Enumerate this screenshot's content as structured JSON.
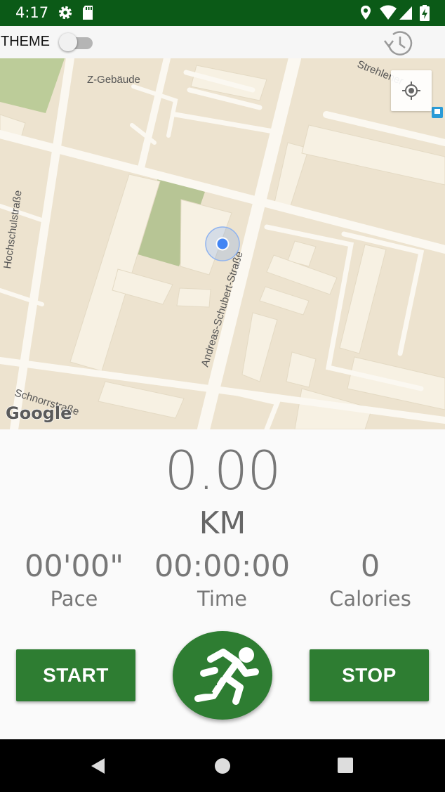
{
  "status_bar": {
    "time": "4:17",
    "icons": [
      "gear-icon",
      "sd-card-icon",
      "location-pin-icon",
      "wifi-icon",
      "signal-icon",
      "battery-charging-icon"
    ]
  },
  "toolbar": {
    "theme_label": "THEME",
    "theme_switch_on": false,
    "history_icon": "history-clock-icon"
  },
  "map": {
    "labels": {
      "z_gebaude": "Z-Gebäude",
      "strehlener": "Strehlener",
      "hochschul": "Hochschulstraße",
      "andreas": "Andreas-Schubert-Straße",
      "schnorr": "Schnorrstraße"
    },
    "attribution": "Google",
    "my_location_icon": "my-location-icon",
    "marker": "current-location-dot"
  },
  "stats": {
    "distance": "0.00",
    "unit": "KM",
    "pace_value": "00'00\"",
    "pace_label": "Pace",
    "time_value": "00:00:00",
    "time_label": "Time",
    "calories_value": "0",
    "calories_label": "Calories"
  },
  "actions": {
    "start_label": "START",
    "stop_label": "STOP",
    "run_icon": "running-person-icon"
  },
  "nav_bar": {
    "icons": [
      "back-icon",
      "home-icon",
      "recents-icon"
    ]
  },
  "colors": {
    "status_bar": "#0b5a17",
    "button_green": "#2e7d32",
    "map_bg": "#ede3cf",
    "location_blue": "#4285f4"
  }
}
